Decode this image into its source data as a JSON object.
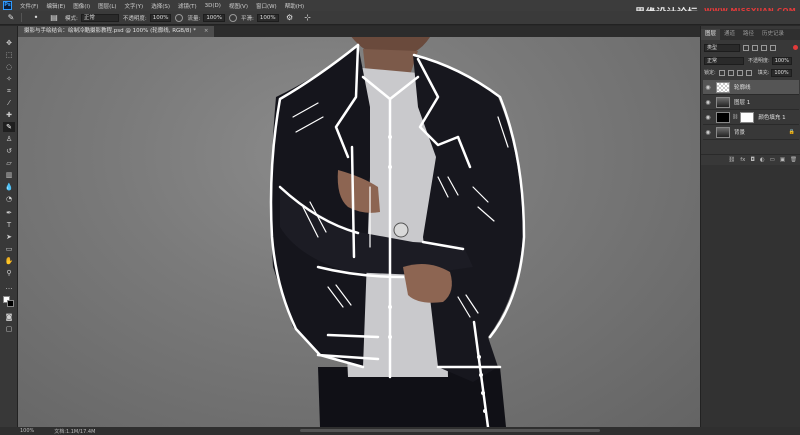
{
  "menu": {
    "items": [
      "文件(F)",
      "编辑(E)",
      "图像(I)",
      "图层(L)",
      "文字(Y)",
      "选择(S)",
      "滤镜(T)",
      "3D(D)",
      "视图(V)",
      "窗口(W)",
      "帮助(H)"
    ]
  },
  "watermark": {
    "cn": "思缘设计论坛",
    "url": "WWW.MISSYUAN.COM"
  },
  "options": {
    "mode_label": "模式:",
    "mode_value": "正常",
    "opacity_label": "不透明度:",
    "opacity_value": "100%",
    "flow_label": "流量:",
    "flow_value": "100%",
    "smooth_label": "平滑:",
    "smooth_value": "100%"
  },
  "document": {
    "tab_title": "摄影与手绘结合：绘制冷酷摄影教程.psd @ 100% (轮廓线, RGB/8) *",
    "close": "×"
  },
  "status": {
    "zoom": "100%",
    "doc": "文档:1.1M/17.4M"
  },
  "layers_panel": {
    "tabs": [
      "图层",
      "通道",
      "路径",
      "历史记录"
    ],
    "filter_value": "类型",
    "blend_value": "正常",
    "opacity_label": "不透明度:",
    "opacity_value": "100%",
    "lock_label": "锁定:",
    "fill_label": "填充:",
    "fill_value": "100%",
    "layers": [
      {
        "name": "轮廓线",
        "selected": true,
        "thumb": "checker"
      },
      {
        "name": "图层 1",
        "selected": false,
        "thumb": "photo"
      },
      {
        "name": "颜色填充 1",
        "selected": false,
        "thumb": "black-mask"
      },
      {
        "name": "背景",
        "selected": false,
        "thumb": "photo"
      }
    ],
    "footer": [
      "fx",
      "◘",
      "◐",
      "▭",
      "▣",
      "🗑"
    ]
  },
  "tools": [
    "move",
    "marquee",
    "lasso",
    "quick-select",
    "crop",
    "eyedropper",
    "healing",
    "brush",
    "stamp",
    "history-brush",
    "eraser",
    "gradient",
    "blur",
    "dodge",
    "pen",
    "type",
    "path-select",
    "shape",
    "hand",
    "zoom"
  ],
  "colors": {
    "accent": "#2f9bff",
    "canvas": "#7a7a7a",
    "panel": "#383838"
  }
}
